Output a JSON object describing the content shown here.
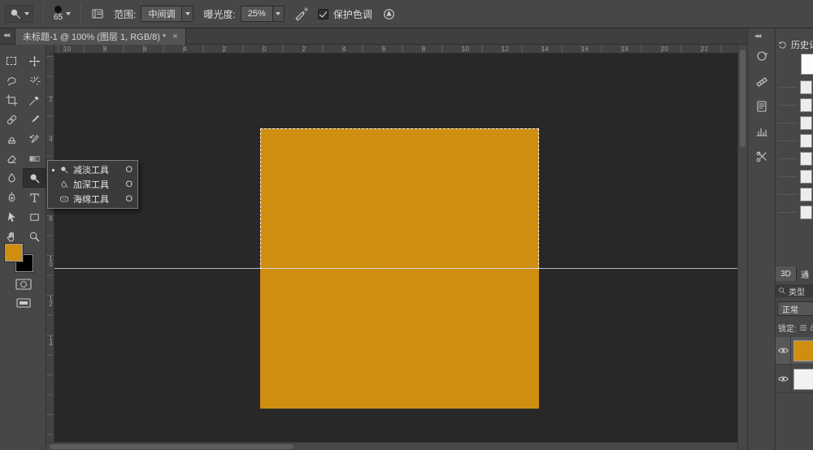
{
  "options_bar": {
    "brush_size": "65",
    "range_label": "范围:",
    "range_value": "中间调",
    "exposure_label": "曝光度:",
    "exposure_value": "25%",
    "protect_tones_label": "保护色调"
  },
  "tab_bar": {
    "doc_tab": "未标题-1 @ 100% (图层 1, RGB/8) *",
    "close_glyph": "×"
  },
  "left_dock": {
    "collapse_arrows": "◀◀"
  },
  "tool_flyout": {
    "items": [
      {
        "label": "减淡工具",
        "shortcut": "O",
        "active": true
      },
      {
        "label": "加深工具",
        "shortcut": "O",
        "active": false
      },
      {
        "label": "海绵工具",
        "shortcut": "O",
        "active": false
      }
    ]
  },
  "rulers": {
    "h_labels": [
      "10",
      "8",
      "6",
      "4",
      "2",
      "0",
      "2",
      "4",
      "6",
      "8",
      "10",
      "12",
      "14",
      "16",
      "18",
      "20",
      "22"
    ],
    "v_labels": [
      "2",
      "4",
      "6",
      "8",
      "10",
      "12",
      "14"
    ]
  },
  "canvas": {
    "fill_color": "#cf8e10",
    "background": "#282828"
  },
  "colors": {
    "foreground_swatch": "#cf8e10",
    "background_swatch": "#000000"
  },
  "right_dock": {
    "collapse_arrows": "◀◀",
    "history_panel_title": "历史记录",
    "tab_3d": "3D",
    "tab_channels": "通",
    "layers": {
      "filter_label": "类型",
      "blend_mode": "正常",
      "lock_label": "锁定:",
      "layer1_thumb": "#cf8e10",
      "layer2_thumb": "#f2f2f2"
    }
  }
}
